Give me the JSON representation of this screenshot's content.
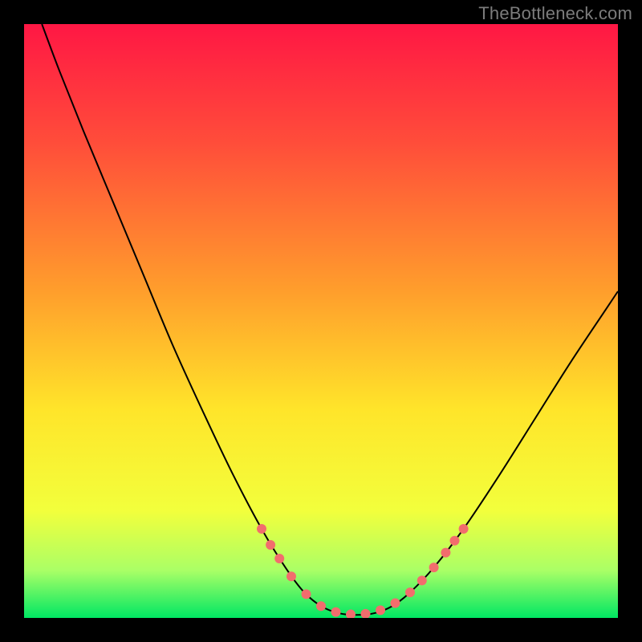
{
  "watermark": "TheBottleneck.com",
  "chart_data": {
    "type": "line",
    "title": "",
    "xlabel": "",
    "ylabel": "",
    "xlim": [
      0,
      100
    ],
    "ylim": [
      0,
      100
    ],
    "gradient_stops": [
      {
        "offset": 0,
        "color": "#ff1744"
      },
      {
        "offset": 20,
        "color": "#ff4d3a"
      },
      {
        "offset": 45,
        "color": "#ff9e2c"
      },
      {
        "offset": 65,
        "color": "#ffe52a"
      },
      {
        "offset": 82,
        "color": "#f2ff3c"
      },
      {
        "offset": 92,
        "color": "#aaff66"
      },
      {
        "offset": 100,
        "color": "#00e763"
      }
    ],
    "series": [
      {
        "name": "bottleneck-curve",
        "color": "#000000",
        "width": 2,
        "points": [
          {
            "x": 3.0,
            "y": 100.0
          },
          {
            "x": 6.0,
            "y": 92.0
          },
          {
            "x": 10.0,
            "y": 82.0
          },
          {
            "x": 15.0,
            "y": 70.0
          },
          {
            "x": 20.0,
            "y": 58.0
          },
          {
            "x": 25.0,
            "y": 46.0
          },
          {
            "x": 30.0,
            "y": 35.0
          },
          {
            "x": 35.0,
            "y": 24.5
          },
          {
            "x": 40.0,
            "y": 15.0
          },
          {
            "x": 44.0,
            "y": 8.5
          },
          {
            "x": 47.0,
            "y": 4.5
          },
          {
            "x": 50.0,
            "y": 2.0
          },
          {
            "x": 53.0,
            "y": 0.8
          },
          {
            "x": 56.0,
            "y": 0.5
          },
          {
            "x": 59.0,
            "y": 0.8
          },
          {
            "x": 62.0,
            "y": 2.0
          },
          {
            "x": 65.0,
            "y": 4.3
          },
          {
            "x": 69.0,
            "y": 8.5
          },
          {
            "x": 74.0,
            "y": 15.0
          },
          {
            "x": 80.0,
            "y": 24.0
          },
          {
            "x": 86.0,
            "y": 33.5
          },
          {
            "x": 92.0,
            "y": 43.0
          },
          {
            "x": 98.0,
            "y": 52.0
          },
          {
            "x": 100.0,
            "y": 55.0
          }
        ]
      },
      {
        "name": "highlight-dots",
        "color": "#f26d6d",
        "type": "scatter",
        "radius": 6,
        "points": [
          {
            "x": 40.0,
            "y": 15.0
          },
          {
            "x": 41.5,
            "y": 12.3
          },
          {
            "x": 43.0,
            "y": 10.0
          },
          {
            "x": 45.0,
            "y": 7.0
          },
          {
            "x": 47.5,
            "y": 4.0
          },
          {
            "x": 50.0,
            "y": 2.0
          },
          {
            "x": 52.5,
            "y": 1.0
          },
          {
            "x": 55.0,
            "y": 0.6
          },
          {
            "x": 57.5,
            "y": 0.7
          },
          {
            "x": 60.0,
            "y": 1.3
          },
          {
            "x": 62.5,
            "y": 2.5
          },
          {
            "x": 65.0,
            "y": 4.3
          },
          {
            "x": 67.0,
            "y": 6.3
          },
          {
            "x": 69.0,
            "y": 8.5
          },
          {
            "x": 71.0,
            "y": 11.0
          },
          {
            "x": 72.5,
            "y": 13.0
          },
          {
            "x": 74.0,
            "y": 15.0
          }
        ]
      }
    ]
  }
}
